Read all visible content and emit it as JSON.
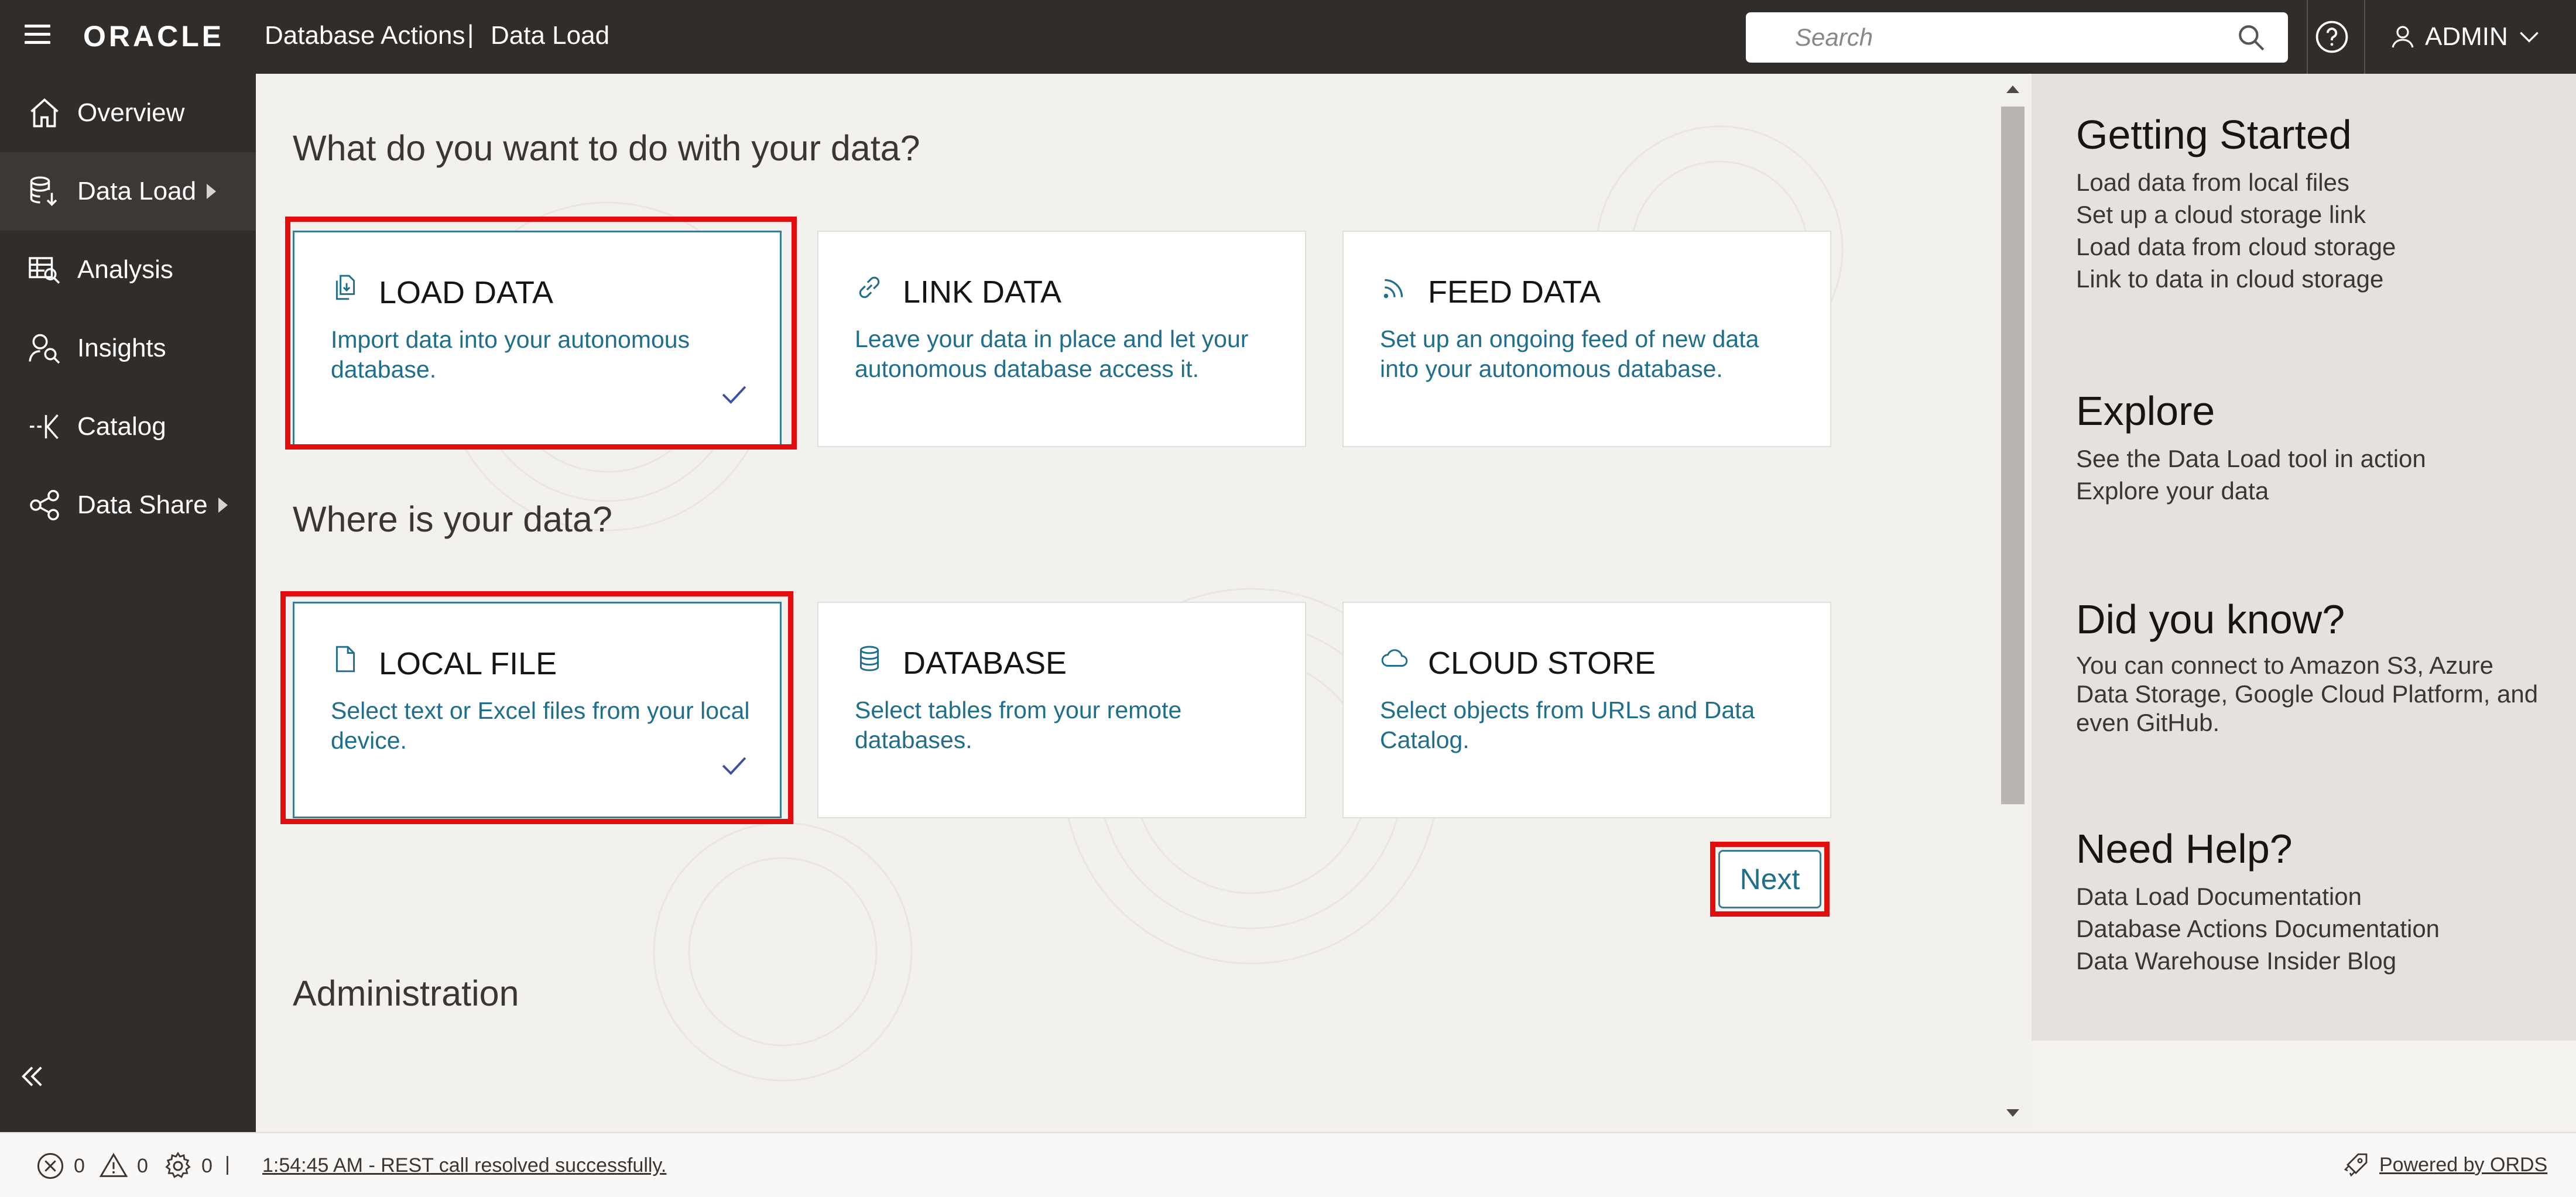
{
  "header": {
    "logo": "ORACLE",
    "app_title": "Database Actions",
    "separator": "|",
    "page_name": "Data Load",
    "search_placeholder": "Search",
    "user": "ADMIN"
  },
  "sidebar": {
    "items": [
      {
        "label": "Overview",
        "icon": "home-icon"
      },
      {
        "label": "Data Load",
        "icon": "data-load-icon"
      },
      {
        "label": "Analysis",
        "icon": "analysis-icon"
      },
      {
        "label": "Insights",
        "icon": "insights-icon"
      },
      {
        "label": "Catalog",
        "icon": "catalog-icon"
      },
      {
        "label": "Data Share",
        "icon": "data-share-icon"
      }
    ],
    "active": "Data Load"
  },
  "main": {
    "question1": "What do you want to do with your data?",
    "question2": "Where is your data?",
    "administration": "Administration",
    "action_cards": [
      {
        "title": "LOAD DATA",
        "desc": "Import data into your autonomous database.",
        "selected": true,
        "icon": "load-data-icon"
      },
      {
        "title": "LINK DATA",
        "desc": "Leave your data in place and let your autonomous database access it.",
        "selected": false,
        "icon": "link-icon"
      },
      {
        "title": "FEED DATA",
        "desc": "Set up an ongoing feed of new data into your autonomous database.",
        "selected": false,
        "icon": "feed-icon"
      }
    ],
    "source_cards": [
      {
        "title": "LOCAL FILE",
        "desc": "Select text or Excel files from your local device.",
        "selected": true,
        "icon": "file-icon"
      },
      {
        "title": "DATABASE",
        "desc": "Select tables from your remote databases.",
        "selected": false,
        "icon": "database-icon"
      },
      {
        "title": "CLOUD STORE",
        "desc": "Select objects from URLs and Data Catalog.",
        "selected": false,
        "icon": "cloud-icon"
      }
    ],
    "next_label": "Next"
  },
  "right_panel": {
    "getting_started": {
      "title": "Getting Started",
      "links": [
        "Load data from local files",
        "Set up a cloud storage link",
        "Load data from cloud storage",
        "Link to data in cloud storage"
      ]
    },
    "explore": {
      "title": "Explore",
      "links": [
        "See the Data Load tool in action",
        "Explore your data"
      ]
    },
    "did_you_know": {
      "title": "Did you know?",
      "text": "You can connect to Amazon S3, Azure Data Storage, Google Cloud Platform, and even GitHub."
    },
    "need_help": {
      "title": "Need Help?",
      "links": [
        "Data Load Documentation",
        "Database Actions Documentation",
        "Data Warehouse Insider Blog"
      ]
    }
  },
  "statusbar": {
    "errors": "0",
    "warnings": "0",
    "processes": "0",
    "divider": "|",
    "message": "1:54:45 AM - REST call resolved successfully.",
    "powered_by": "Powered by ORDS"
  },
  "colors": {
    "topbar": "#312d2a",
    "accent": "#1f6e8c",
    "highlight": "#e20d0d"
  }
}
